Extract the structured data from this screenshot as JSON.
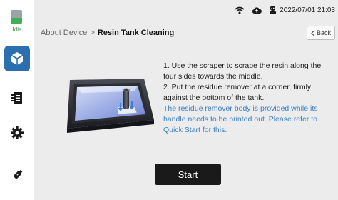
{
  "sidebar": {
    "status_label": "Idle",
    "items": [
      {
        "icon": "cube-icon",
        "active": true
      },
      {
        "icon": "notebook-icon",
        "active": false
      },
      {
        "icon": "gear-icon",
        "active": false
      },
      {
        "icon": "usb-drive-icon",
        "active": false
      }
    ]
  },
  "topbar": {
    "datetime": "2022/07/01  21:03",
    "icons": [
      "wifi-icon",
      "cloud-icon",
      "robot-icon"
    ]
  },
  "header": {
    "breadcrumb_parent": "About Device",
    "breadcrumb_separator": ">",
    "breadcrumb_current": "Resin Tank Cleaning",
    "back_label": "Back"
  },
  "instructions": {
    "step1": "1. Use the scraper to scrape the resin along the four sides towards the middle.",
    "step2": "2. Put the residue remover at a corner, firmly against the bottom of the tank.",
    "note": "The residue remover body is provided while its handle needs to be printed out. Please refer to Quick Start for this."
  },
  "start_label": "Start",
  "colors": {
    "accent": "#2a6fb0",
    "note_text": "#3a7fc6",
    "status_green": "#3fae55"
  }
}
